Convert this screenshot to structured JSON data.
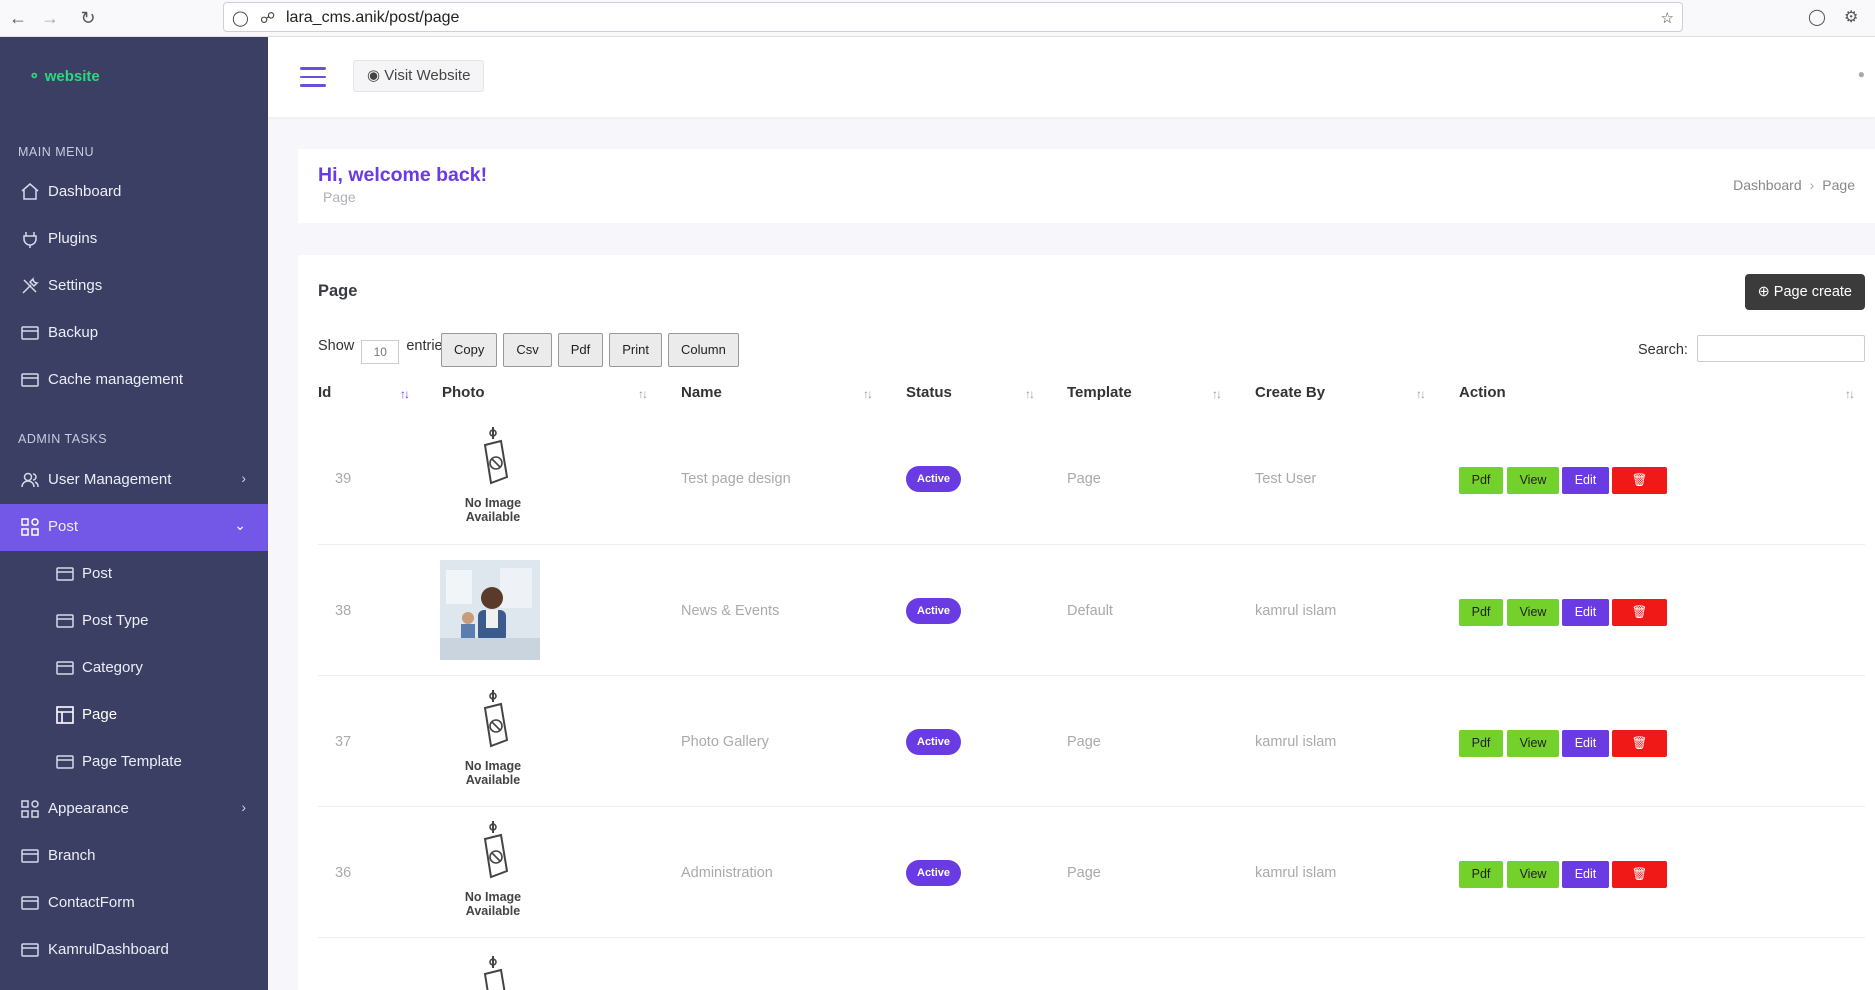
{
  "browser": {
    "url": "lara_cms.anik/post/page"
  },
  "sidebar": {
    "brand": "website",
    "main_menu_heading": "MAIN MENU",
    "admin_tasks_heading": "ADMIN TASKS",
    "main_items": [
      {
        "label": "Dashboard",
        "icon": "home-icon"
      },
      {
        "label": "Plugins",
        "icon": "plug-icon"
      },
      {
        "label": "Settings",
        "icon": "tools-icon"
      },
      {
        "label": "Backup",
        "icon": "card-icon"
      },
      {
        "label": "Cache management",
        "icon": "card-icon"
      }
    ],
    "admin_items": [
      {
        "label": "User Management",
        "icon": "users-icon",
        "expandable": true
      },
      {
        "label": "Post",
        "icon": "grid-icon",
        "expanded": true,
        "active": true
      },
      {
        "label": "Post",
        "icon": "card-icon",
        "sub": true
      },
      {
        "label": "Post Type",
        "icon": "card-icon",
        "sub": true
      },
      {
        "label": "Category",
        "icon": "card-icon",
        "sub": true
      },
      {
        "label": "Page",
        "icon": "layout-icon",
        "sub": true,
        "current": true
      },
      {
        "label": "Page Template",
        "icon": "card-icon",
        "sub": true
      },
      {
        "label": "Appearance",
        "icon": "grid-icon",
        "expandable": true
      },
      {
        "label": "Branch",
        "icon": "card-icon"
      },
      {
        "label": "ContactForm",
        "icon": "card-icon"
      },
      {
        "label": "KamrulDashboard",
        "icon": "card-icon"
      }
    ]
  },
  "topbar": {
    "visit_label": "Visit Website"
  },
  "welcome": {
    "title": "Hi, welcome back!",
    "subtitle": "Page",
    "breadcrumb": [
      "Dashboard",
      "Page"
    ]
  },
  "card": {
    "title": "Page",
    "create_label": "Page create",
    "show_label": "Show",
    "entries_value": "10",
    "entries_label": "entries",
    "search_label": "Search:",
    "buttons": [
      "Copy",
      "Csv",
      "Pdf",
      "Print",
      "Column"
    ]
  },
  "table": {
    "columns": [
      "Id",
      "Photo",
      "Name",
      "Status",
      "Template",
      "Create By",
      "Action"
    ],
    "no_image_text": "No Image Available",
    "action_labels": {
      "pdf": "Pdf",
      "view": "View",
      "edit": "Edit",
      "delete": "Delete"
    },
    "rows": [
      {
        "id": "39",
        "photo": "none",
        "name": "Test page design",
        "status": "Active",
        "template": "Page",
        "create_by": "Test User"
      },
      {
        "id": "38",
        "photo": "image",
        "name": "News & Events",
        "status": "Active",
        "template": "Default",
        "create_by": "kamrul islam"
      },
      {
        "id": "37",
        "photo": "none",
        "name": "Photo Gallery",
        "status": "Active",
        "template": "Page",
        "create_by": "kamrul islam"
      },
      {
        "id": "36",
        "photo": "none",
        "name": "Administration",
        "status": "Active",
        "template": "Page",
        "create_by": "kamrul islam"
      }
    ]
  },
  "colors": {
    "sidebar_bg": "#3b3f63",
    "accent": "#7357e6",
    "brand_green": "#2bd97c",
    "success": "#74d12b",
    "danger": "#f11818"
  }
}
